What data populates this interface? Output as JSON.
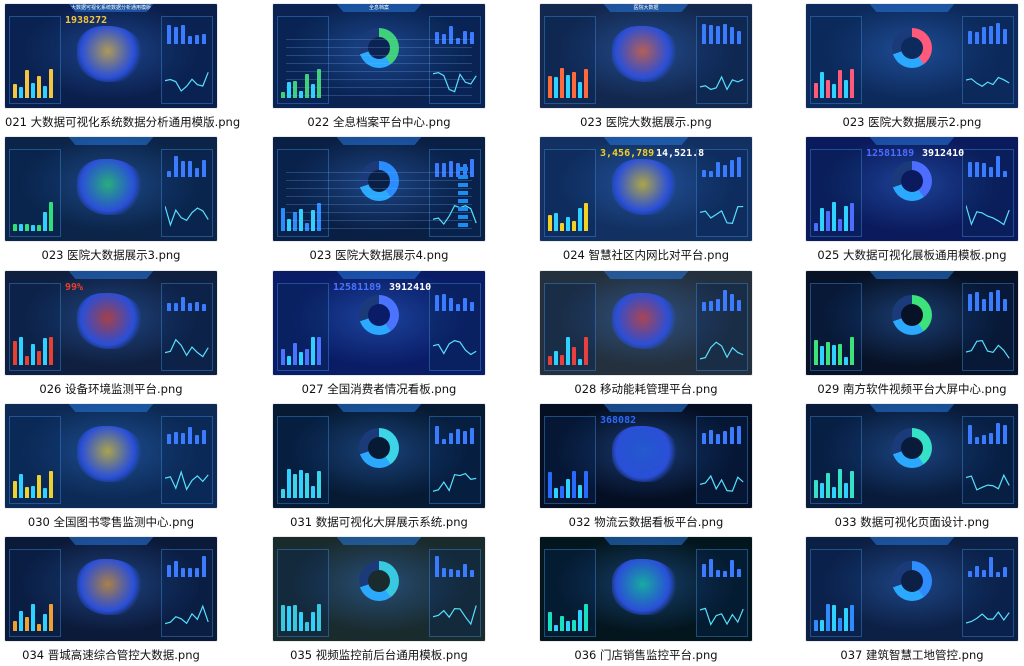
{
  "items": [
    {
      "caption": "021 大数据可视化系统数据分析通用模版.png",
      "bg": "#0b1f4d",
      "accent": "#f5c542",
      "number": "1938272",
      "title": "大数据可视化系统数据分析通用模版"
    },
    {
      "caption": "022 全息档案平台中心.png",
      "bg": "#0a2352",
      "accent": "#3fd07a",
      "title": "全息档案"
    },
    {
      "caption": "023 医院大数据展示.png",
      "bg": "#13284f",
      "accent": "#ff6a3d",
      "title": "医院大数据"
    },
    {
      "caption": "023 医院大数据展示2.png",
      "bg": "#0d2a5c",
      "accent": "#ff5a7a"
    },
    {
      "caption": "023 医院大数据展示3.png",
      "bg": "#0b2448",
      "accent": "#2ee07a"
    },
    {
      "caption": "023 医院大数据展示4.png",
      "bg": "#0a1f44",
      "accent": "#2a8cff"
    },
    {
      "caption": "024 智慧社区内网比对平台.png",
      "bg": "#123061",
      "accent": "#f2d024",
      "number": "3,456,789",
      "number2": "14,521.8"
    },
    {
      "caption": "025 大数据可视化展板通用模板.png",
      "bg": "#0b1a5c",
      "accent": "#4d6dff",
      "number": "12581189",
      "number2": "3912410"
    },
    {
      "caption": "026 设备环境监测平台.png",
      "bg": "#0f1f3f",
      "accent": "#e8402f",
      "number": "99%"
    },
    {
      "caption": "027 全国消费者情况看板.png",
      "bg": "#0a1c66",
      "accent": "#4a74ff",
      "number": "12581189",
      "number2": "3912410"
    },
    {
      "caption": "028 移动能耗管理平台.png",
      "bg": "#24303d",
      "accent": "#e84040"
    },
    {
      "caption": "029 南方软件视频平台大屏中心.png",
      "bg": "#071226",
      "accent": "#3be37a"
    },
    {
      "caption": "030 全国图书零售监测中心.png",
      "bg": "#0c2a55",
      "accent": "#f0d030"
    },
    {
      "caption": "031 数据可视化大屏展示系统.png",
      "bg": "#061a33",
      "accent": "#3cd5e8"
    },
    {
      "caption": "032 物流云数据看板平台.png",
      "bg": "#050f24",
      "accent": "#2a6bff",
      "number": "368082"
    },
    {
      "caption": "033 数据可视化页面设计.png",
      "bg": "#081b3a",
      "accent": "#35e2c8"
    },
    {
      "caption": "034 晋城高速综合管控大数据.png",
      "bg": "#0c1a3a",
      "accent": "#f0a030"
    },
    {
      "caption": "035 视频监控前后台通用模板.png",
      "bg": "#1a2b2e",
      "accent": "#38c8e0"
    },
    {
      "caption": "036 门店销售监控平台.png",
      "bg": "#03161e",
      "accent": "#19e0c0"
    },
    {
      "caption": "037 建筑智慧工地管控.png",
      "bg": "#0c1f44",
      "accent": "#2e8cff"
    }
  ]
}
